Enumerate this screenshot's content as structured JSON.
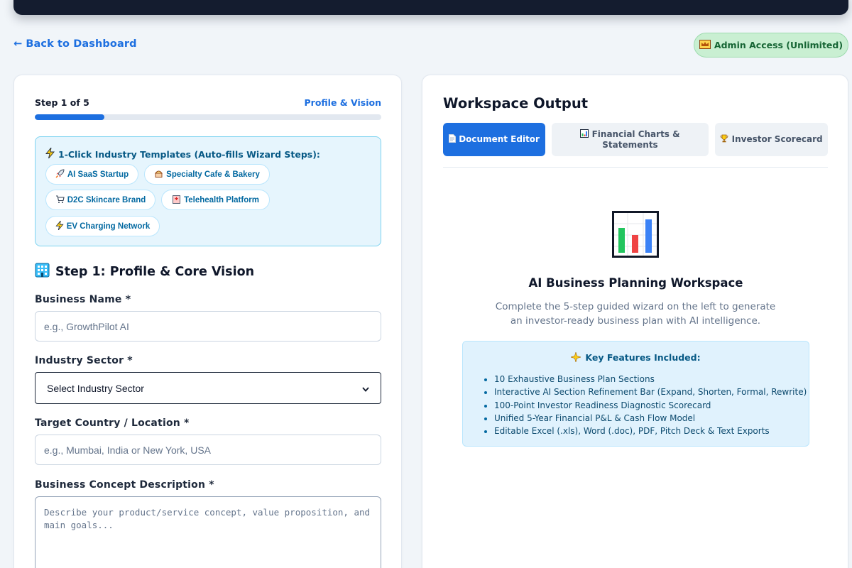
{
  "nav": {
    "back_label": "← Back to Dashboard",
    "admin_badge": "Admin Access (Unlimited)"
  },
  "wizard": {
    "step_count": "Step 1 of 5",
    "step_name": "Profile & Vision",
    "progress": 0.2,
    "templates_title": "1-Click Industry Templates (Auto-fills Wizard Steps):",
    "templates": [
      {
        "label": "AI SaaS Startup",
        "icon": "rocket-icon"
      },
      {
        "label": "Specialty Cafe & Bakery",
        "icon": "cake-icon"
      },
      {
        "label": "D2C Skincare Brand",
        "icon": "cart-icon"
      },
      {
        "label": "Telehealth Platform",
        "icon": "hospital-icon"
      },
      {
        "label": "EV Charging Network",
        "icon": "lightning-icon"
      }
    ],
    "section_title": "Step 1: Profile & Core Vision",
    "fields": {
      "business_name": {
        "label": "Business Name *",
        "placeholder": "e.g., GrowthPilot AI"
      },
      "industry_sector": {
        "label": "Industry Sector *",
        "selected": "Select Industry Sector"
      },
      "target_country": {
        "label": "Target Country / Location *",
        "placeholder": "e.g., Mumbai, India or New York, USA"
      },
      "concept": {
        "label": "Business Concept Description *",
        "placeholder": "Describe your product/service concept, value proposition, and main goals..."
      }
    }
  },
  "workspace": {
    "title": "Workspace Output",
    "tabs": [
      {
        "label": "Document Editor",
        "icon": "document-icon",
        "active": true
      },
      {
        "label": "Financial Charts & Statements",
        "icon": "chart-icon",
        "active": false
      },
      {
        "label": "Investor Scorecard",
        "icon": "trophy-icon",
        "active": false
      }
    ],
    "heading": "AI Business Planning Workspace",
    "description": "Complete the 5-step guided wizard on the left to generate an investor-ready business plan with AI intelligence.",
    "features_title": "Key Features Included:",
    "features": [
      "10 Exhaustive Business Plan Sections",
      "Interactive AI Section Refinement Bar (Expand, Shorten, Formal, Rewrite)",
      "100-Point Investor Readiness Diagnostic Scorecard",
      "Unified 5-Year Financial P&L & Cash Flow Model",
      "Editable Excel (.xls), Word (.doc), PDF, Pitch Deck & Text Exports"
    ]
  },
  "colors": {
    "accent": "#1d6fe0",
    "topbar": "#141c2f",
    "badge_bg": "#c9efd2",
    "template_panel": "#e6f5fd"
  }
}
